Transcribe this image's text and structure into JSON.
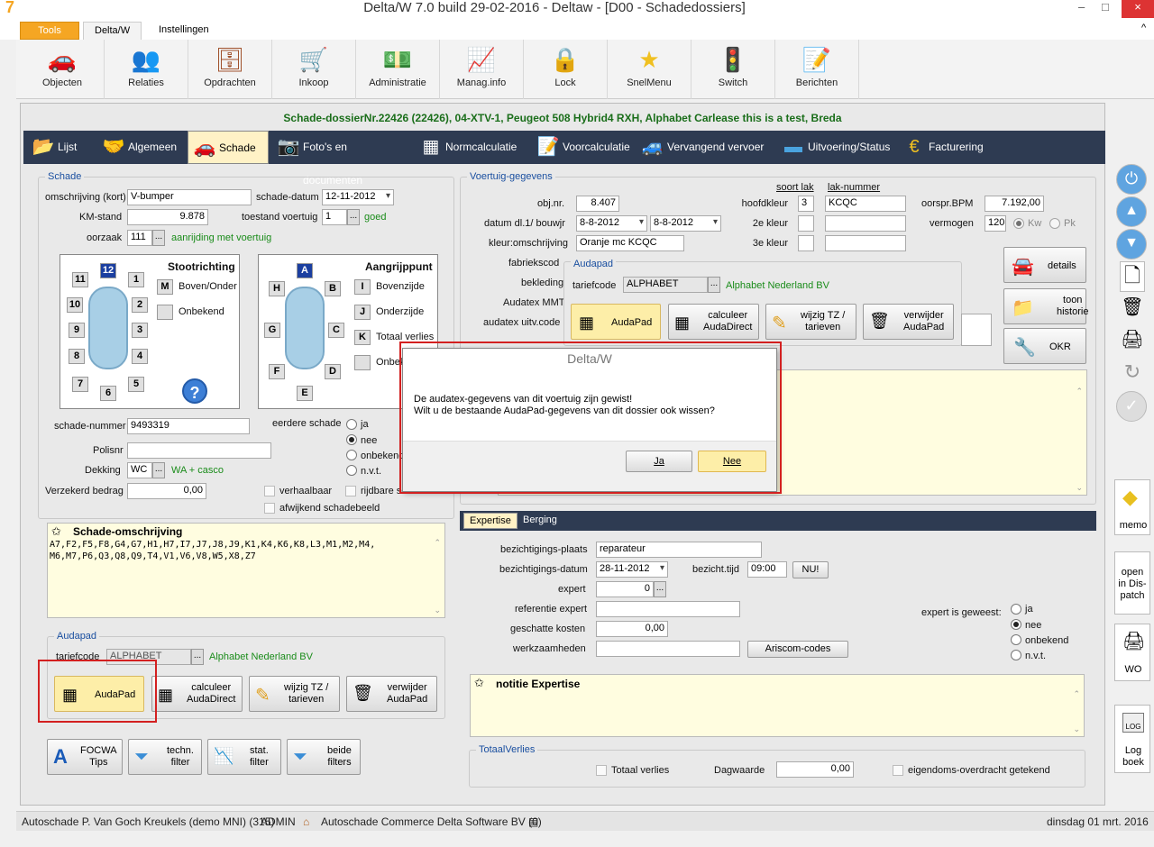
{
  "window": {
    "title": "Delta/W 7.0 build 29-02-2016 - Deltaw - [D00 - Schadedossiers]",
    "logo": "7",
    "min": "–",
    "max": "□",
    "close": "×"
  },
  "ribbon_tabs": [
    "Tools",
    "Delta/W",
    "Instellingen"
  ],
  "ribbon_collapse": "^",
  "ribbon_buttons": [
    {
      "label": "Objecten",
      "icon": "car-icon"
    },
    {
      "label": "Relaties",
      "icon": "people-icon"
    },
    {
      "label": "Opdrachten",
      "icon": "cabinet-icon"
    },
    {
      "label": "Inkoop",
      "icon": "cart-icon"
    },
    {
      "label": "Administratie",
      "icon": "money-icon"
    },
    {
      "label": "Manag.info",
      "icon": "chart-icon"
    },
    {
      "label": "Lock",
      "icon": "lock-icon"
    },
    {
      "label": "SnelMenu",
      "icon": "star-icon"
    },
    {
      "label": "Switch",
      "icon": "traffic-light-icon"
    },
    {
      "label": "Berichten",
      "icon": "notepad-icon"
    }
  ],
  "header": "Schade-dossierNr.22426 (22426), 04-XTV-1, Peugeot 508 Hybrid4 RXH, Alphabet Carlease this is a test, Breda",
  "nav_tabs": [
    {
      "label": "Lijst"
    },
    {
      "label": "Algemeen"
    },
    {
      "label": "Schade"
    },
    {
      "label": "Foto's en documenten"
    },
    {
      "label": "Normcalculatie"
    },
    {
      "label": "Voorcalculatie"
    },
    {
      "label": "Vervangend vervoer"
    },
    {
      "label": "Uitvoering/Status"
    },
    {
      "label": "Facturering"
    }
  ],
  "schade": {
    "title": "Schade",
    "omschrijving_label": "omschrijving (kort)",
    "omschrijving": "V-bumper",
    "schadedatum_label": "schade-datum",
    "schadedatum": "12-11-2012",
    "km_label": "KM-stand",
    "km": "9.878",
    "toestand_label": "toestand voertuig",
    "toestand": "1",
    "toestand_text": "goed",
    "oorzaak_label": "oorzaak",
    "oorzaak": "111",
    "oorzaak_text": "aanrijding met voertuig",
    "stoot_title": "Stootrichting",
    "stoot_m": "M",
    "stoot_m_label": "Boven/Onder",
    "stoot_onbekend": "Onbekend",
    "stoot_nums": [
      "11",
      "12",
      "1",
      "10",
      "2",
      "9",
      "3",
      "8",
      "4",
      "7",
      "6",
      "5"
    ],
    "aangrijp_title": "Aangrijppunt",
    "aangrijp_letters": [
      "A",
      "H",
      "B",
      "G",
      "C",
      "F",
      "D",
      "E"
    ],
    "aangrijp_opts": [
      {
        "k": "I",
        "v": "Bovenzijde"
      },
      {
        "k": "J",
        "v": "Onderzijde"
      },
      {
        "k": "K",
        "v": "Totaal verlies"
      },
      {
        "k": "",
        "v": "Onbekend"
      }
    ],
    "help": "?",
    "schadenummer_label": "schade-nummer",
    "schadenummer": "9493319",
    "polisnr_label": "Polisnr",
    "polisnr": "",
    "dekking_label": "Dekking",
    "dekking": "WC",
    "dekking_text": "WA + casco",
    "verzekerd_label": "Verzekerd bedrag",
    "verzekerd": "0,00",
    "eerdere_label": "eerdere schade",
    "eerdere_opts": [
      "ja",
      "nee",
      "onbekend",
      "n.v.t."
    ],
    "verhaalbaar": "verhaalbaar",
    "rijdbaar": "rijdbare schade",
    "afwijkend": "afwijkend schadebeeld",
    "omschr_title": "Schade-omschrijving",
    "omschr_text": "A7,F2,F5,F8,G4,G7,H1,H7,I7,J7,J8,J9,K1,K4,K6,K8,L3,M1,M2,M4,\nM6,M7,P6,Q3,Q8,Q9,T4,V1,V6,V8,W5,X8,Z7"
  },
  "audapad_left": {
    "title": "Audapad",
    "tarief_label": "tariefcode",
    "tarief": "ALPHABET",
    "tarief_text": "Alphabet Nederland BV",
    "b1": "AudaPad",
    "b2": "calculeer\nAudaDirect",
    "b3": "wijzig TZ /\ntarieven",
    "b4": "verwijder\nAudaPad"
  },
  "tools": [
    {
      "label": "FOCWA\nTips"
    },
    {
      "label": "techn.\nfilter"
    },
    {
      "label": "stat.\nfilter"
    },
    {
      "label": "beide\nfilters"
    }
  ],
  "voertuig": {
    "title": "Voertuig-gegevens",
    "objnr_label": "obj.nr.",
    "objnr": "8.407",
    "datum_label": "datum dl.1/ bouwjr",
    "datum1": "8-8-2012",
    "datum2": "8-8-2012",
    "kleur_label": "kleur:omschrijving",
    "kleur": "Oranje mc KCQC",
    "fabriek_label": "fabriekscod",
    "bekleding_label": "bekleding",
    "audatex_label": "Audatex MMT",
    "audatexuitv_label": "audatex uitv.code",
    "soortlak": "soort lak",
    "laknr": "lak-nummer",
    "hoofdkleur_label": "hoofdkleur",
    "hoofdkleur_soort": "3",
    "hoofdkleur": "KCQC",
    "kleur2_label": "2e kleur",
    "kleur3_label": "3e kleur",
    "bpm_label": "oorspr.BPM",
    "bpm": "7.192,00",
    "vermogen_label": "vermogen",
    "vermogen": "120",
    "kw": "Kw",
    "pk": "Pk"
  },
  "audapad_right": {
    "title": "Audapad",
    "tarief_label": "tariefcode",
    "tarief": "ALPHABET",
    "tarief_text": "Alphabet Nederland BV",
    "b1": "AudaPad",
    "b2": "calculeer\nAudaDirect",
    "b3": "wijzig TZ /\ntarieven",
    "b4": "verwijder\nAudaPad"
  },
  "right_btns": {
    "details": "details",
    "historie": "toon\nhistorie",
    "okr": "OKR"
  },
  "expertise": {
    "tabs": [
      "Expertise",
      "Berging"
    ],
    "plaats_label": "bezichtigings-plaats",
    "plaats": "reparateur",
    "datum_label": "bezichtigings-datum",
    "datum": "28-11-2012",
    "tijd_label": "bezicht.tijd",
    "tijd": "09:00",
    "nu": "NU!",
    "expert_label": "expert",
    "expert": "0",
    "ref_label": "referentie expert",
    "ref": "",
    "kosten_label": "geschatte kosten",
    "kosten": "0,00",
    "werk_label": "werkzaamheden",
    "werk": "",
    "ariscom": "Ariscom-codes",
    "geweest_label": "expert is geweest:",
    "geweest_opts": [
      "ja",
      "nee",
      "onbekend",
      "n.v.t."
    ],
    "notitie": "notitie Expertise"
  },
  "totaal": {
    "title": "TotaalVerlies",
    "tv_label": "Totaal verlies",
    "dag_label": "Dagwaarde",
    "dag": "0,00",
    "eigendom": "eigendoms-overdracht getekend"
  },
  "sidebar": {
    "memo": "memo",
    "dispatch": "open\nin Dis-\npatch",
    "wo": "WO",
    "log": "Log\nboek",
    "log_badge": "LOG"
  },
  "dialog": {
    "title": "Delta/W",
    "line1": "De audatex-gegevens van dit voertuig zijn gewist!",
    "line2": "Wilt u de bestaande AudaPad-gegevens van dit dossier ook wissen?",
    "ja": "Ja",
    "nee": "Nee"
  },
  "status": {
    "s1": "Autoschade P. Van Goch Kreukels (demo MNI) (315)",
    "s2": "ADMIN",
    "s3": "Autoschade Commerce Delta Software BV (0)",
    "s4": "dinsdag 01 mrt. 2016"
  },
  "colors": {
    "accent": "#f5a623",
    "nav": "#2e3b52",
    "green": "#1a8c1a",
    "red_frame": "#d32020",
    "group_title": "#1a4fa0"
  }
}
